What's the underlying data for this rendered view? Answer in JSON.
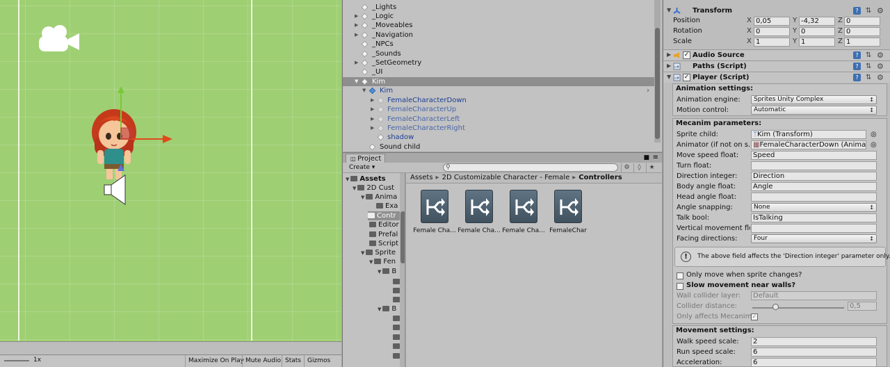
{
  "scene": {
    "game_bar": {
      "zoom_label": "1x",
      "buttons": [
        "Maximize On Play",
        "Mute Audio",
        "Stats",
        "Gizmos"
      ]
    }
  },
  "hierarchy": {
    "rows": [
      {
        "label": "_Lights"
      },
      {
        "label": "_Logic"
      },
      {
        "label": "_Moveables"
      },
      {
        "label": "_Navigation"
      },
      {
        "label": "_NPCs"
      },
      {
        "label": "_Sounds"
      },
      {
        "label": "_SetGeometry"
      },
      {
        "label": "_UI"
      },
      {
        "label": "Kim"
      },
      {
        "label": "Kim"
      },
      {
        "label": "FemaleCharacterDown"
      },
      {
        "label": "FemaleCharacterUp"
      },
      {
        "label": "FemaleCharacterLeft"
      },
      {
        "label": "FemaleCharacterRight"
      },
      {
        "label": "shadow"
      },
      {
        "label": "Sound child"
      }
    ]
  },
  "project": {
    "tab_label": "Project",
    "create_label": "Create",
    "search_placeholder": "",
    "tree": [
      {
        "label": "Assets"
      },
      {
        "label": "2D Cust"
      },
      {
        "label": "Anima"
      },
      {
        "label": "Exa"
      },
      {
        "label": "Contr"
      },
      {
        "label": "Editor"
      },
      {
        "label": "Prefal"
      },
      {
        "label": "Script"
      },
      {
        "label": "Sprite"
      },
      {
        "label": "Fen"
      },
      {
        "label": "B"
      },
      {
        "label": "B"
      }
    ],
    "breadcrumb": [
      "Assets",
      "2D Customizable Character - Female",
      "Controllers"
    ],
    "tiles": [
      "Female Cha...",
      "Female Cha...",
      "Female Cha...",
      "FemaleChar"
    ]
  },
  "inspector": {
    "transform": {
      "title": "Transform",
      "position_label": "Position",
      "position": [
        "0,05",
        "-4,32",
        "0"
      ],
      "rotation_label": "Rotation",
      "rotation": [
        "0",
        "0",
        "0"
      ],
      "scale_label": "Scale",
      "scale": [
        "1",
        "1",
        "1"
      ],
      "axis": [
        "X",
        "Y",
        "Z"
      ]
    },
    "components": {
      "audio_source": "Audio Source",
      "paths": "Paths (Script)",
      "player": "Player (Script)"
    },
    "animation_settings": {
      "title": "Animation settings:",
      "engine_label": "Animation engine:",
      "engine_value": "Sprites Unity Complex",
      "motion_label": "Motion control:",
      "motion_value": "Automatic"
    },
    "mecanim": {
      "title": "Mecanim parameters:",
      "sprite_child_label": "Sprite child:",
      "sprite_child_value": "Kim (Transform)",
      "animator_label": "Animator (if not on s.c",
      "animator_value": "FemaleCharacterDown (Animat",
      "move_speed_label": "Move speed float:",
      "move_speed_value": "Speed",
      "turn_label": "Turn float:",
      "turn_value": "",
      "direction_label": "Direction integer:",
      "direction_value": "Direction",
      "body_angle_label": "Body angle float:",
      "body_angle_value": "Angle",
      "head_angle_label": "Head angle float:",
      "head_angle_value": "",
      "angle_snap_label": "Angle snapping:",
      "angle_snap_value": "None",
      "talk_label": "Talk bool:",
      "talk_value": "IsTalking",
      "vertical_label": "Vertical movement flo",
      "vertical_value": "",
      "facing_label": "Facing directions:",
      "facing_value": "Four",
      "help_text": "The above field affects the 'Direction integer' parameter only.",
      "only_move_label": "Only move when sprite changes?",
      "slow_label": "Slow movement near walls?",
      "wall_layer_label": "Wall collider layer:",
      "wall_layer_value": "Default",
      "collider_dist_label": "Collider distance:",
      "collider_dist_value": "0,5",
      "only_affects_label": "Only affects Mecanim"
    },
    "movement": {
      "title": "Movement settings:",
      "walk_label": "Walk speed scale:",
      "walk_value": "2",
      "run_label": "Run speed scale:",
      "run_value": "6",
      "accel_label": "Acceleration:",
      "accel_value": "6"
    }
  },
  "colors": {
    "scene_green": "#9fcf73",
    "selection_blue_text": "#1c3f92",
    "panel_gray": "#c2c2c2"
  }
}
